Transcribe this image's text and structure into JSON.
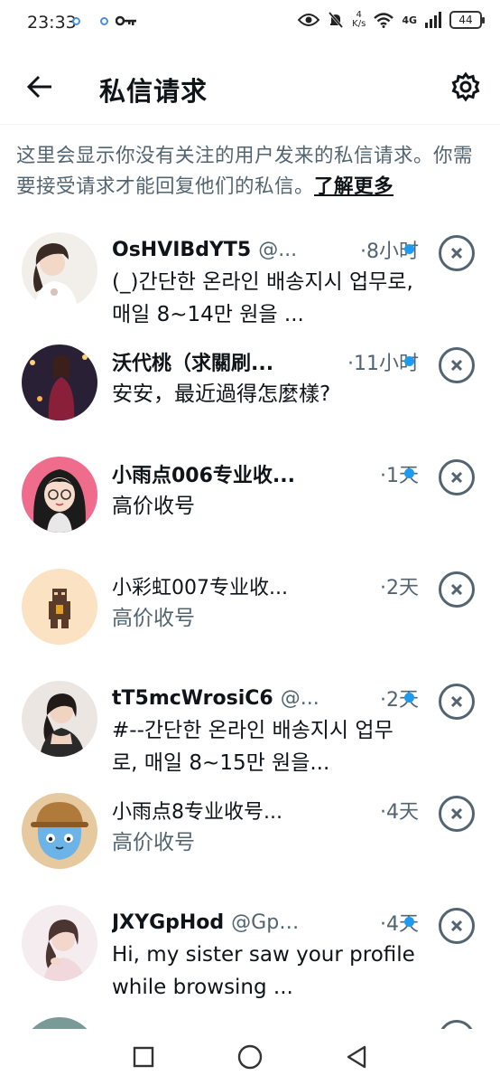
{
  "status_bar": {
    "time": "23:33",
    "net_speed_value": "4",
    "net_speed_unit": "K/s",
    "network": "4G",
    "battery": "44",
    "icons": [
      "notification-dot-icon",
      "notification-dot-icon",
      "key-icon",
      "eye-icon",
      "bell-muted-icon",
      "wifi-icon",
      "signal-icon",
      "battery-icon"
    ]
  },
  "header": {
    "title": "私信请求",
    "back_icon": "arrow-left-icon",
    "settings_icon": "gear-icon"
  },
  "intro": {
    "text": "这里会显示你没有关注的用户发来的私信请求。你需要接受请求才能回复他们的私信。",
    "link": "了解更多"
  },
  "requests": [
    {
      "name": "OsHVIBdYT5",
      "handle": "@...",
      "time": "·8小时",
      "unread": true,
      "message": "(_)간단한 온라인 배송지시 업무로,매일 8~14만 원을 ..."
    },
    {
      "name": "沃代桃（求關刷...",
      "handle": "",
      "time": "·11小时",
      "unread": true,
      "message": "安安，最近過得怎麼樣?"
    },
    {
      "name": "小雨点006专业收...",
      "handle": "",
      "time": "·1天",
      "unread": true,
      "message": "高价收号"
    },
    {
      "name": "小彩虹007专业收...",
      "handle": "",
      "time": "·2天",
      "unread": false,
      "message": "高价收号"
    },
    {
      "name": "tT5mcWrosiC6",
      "handle": "@...",
      "time": "·2天",
      "unread": true,
      "message": "#--간단한 온라인 배송지시 업무로, 매일 8~15만 원을..."
    },
    {
      "name": "小雨点8专业收号...",
      "handle": "",
      "time": "·4天",
      "unread": false,
      "message": "高价收号"
    },
    {
      "name": "JXYGpHod",
      "handle": "@GpH...",
      "time": "·4天",
      "unread": true,
      "message": "Hi, my sister saw your profile while browsing ..."
    }
  ],
  "nav": {
    "icons": [
      "square-recents-icon",
      "circle-home-icon",
      "triangle-back-icon"
    ]
  },
  "colors": {
    "accent": "#1d9bf0",
    "secondary_text": "#536471",
    "primary_text": "#0f1419"
  }
}
